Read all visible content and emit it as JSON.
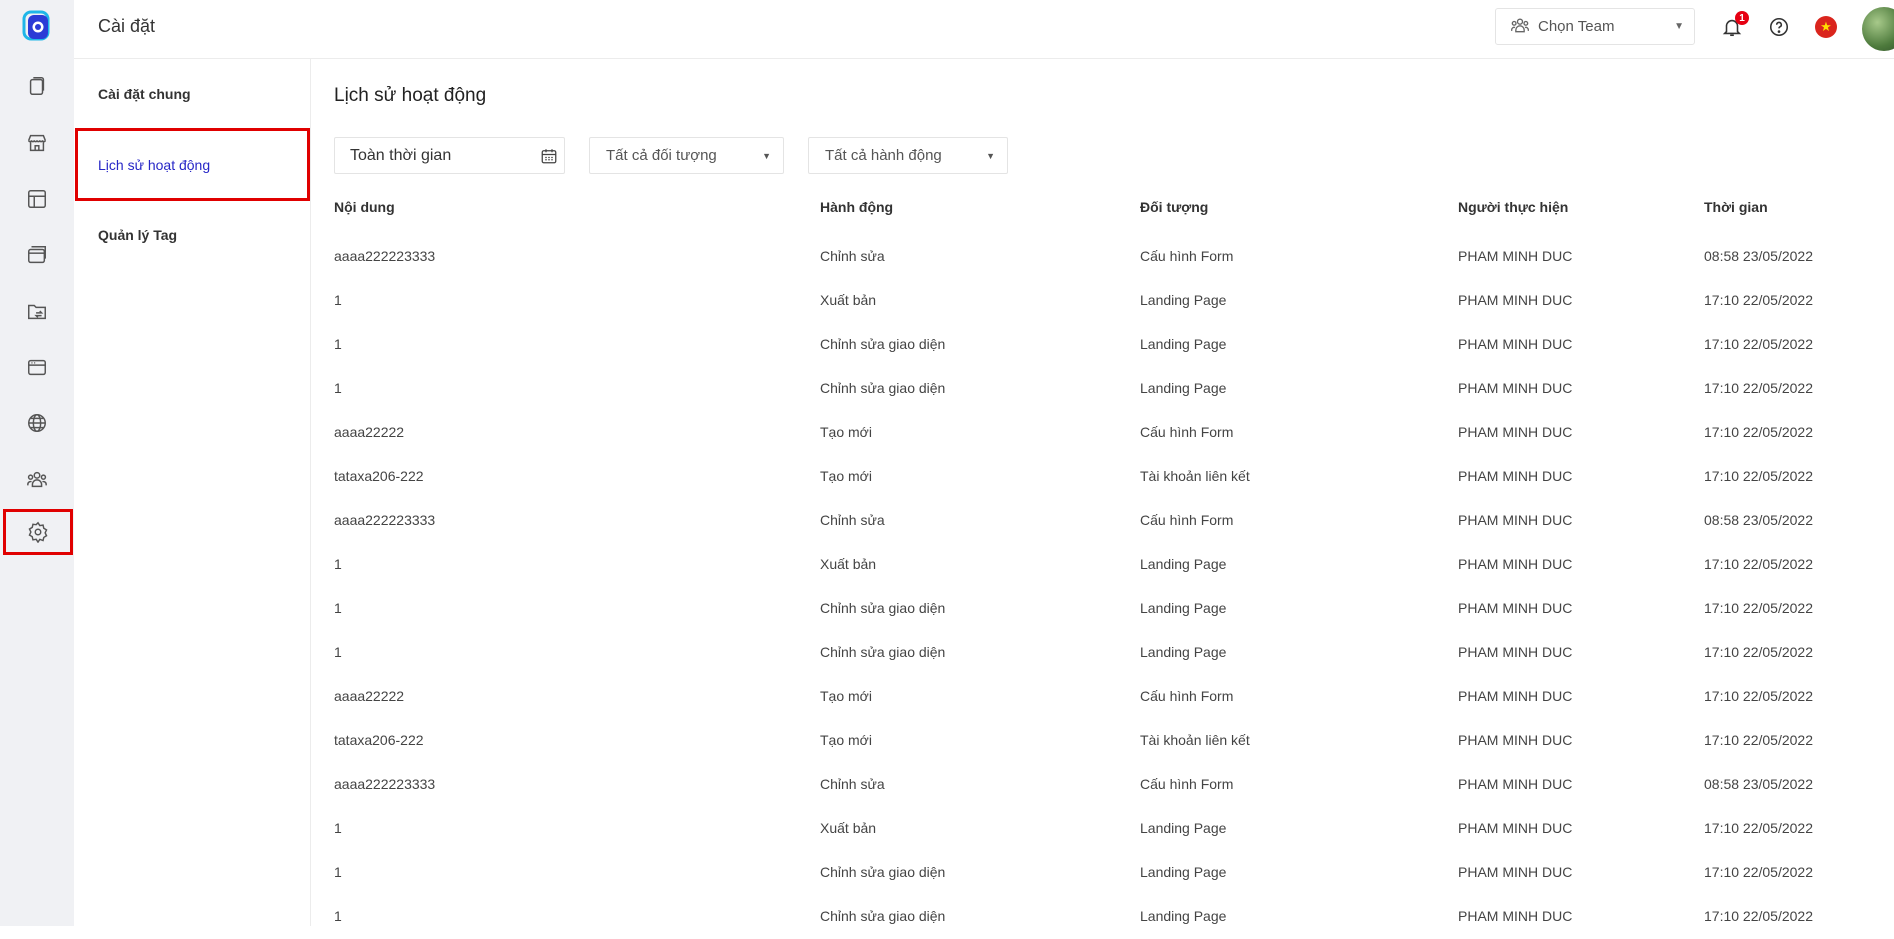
{
  "header": {
    "title": "Cài đặt",
    "team_label": "Chọn Team",
    "notification_count": "1"
  },
  "subnav": {
    "items": [
      "Cài đặt chung",
      "Lịch sử hoạt động",
      "Quản lý Tag"
    ],
    "active_index": 1
  },
  "main": {
    "title": "Lịch sử hoạt động",
    "filters": {
      "date_value": "Toàn thời gian",
      "object_select": "Tất cả đối tượng",
      "action_select": "Tất cả hành động"
    },
    "columns": [
      "Nội dung",
      "Hành động",
      "Đối tượng",
      "Người thực hiện",
      "Thời gian"
    ],
    "rows": [
      [
        "aaaa222223333",
        "Chỉnh sửa",
        "Cấu hình Form",
        "PHAM MINH DUC",
        "08:58 23/05/2022"
      ],
      [
        "1",
        "Xuất bản",
        "Landing Page",
        "PHAM MINH DUC",
        "17:10 22/05/2022"
      ],
      [
        "1",
        "Chỉnh sửa giao diện",
        "Landing Page",
        "PHAM MINH DUC",
        "17:10 22/05/2022"
      ],
      [
        "1",
        "Chỉnh sửa giao diện",
        "Landing Page",
        "PHAM MINH DUC",
        "17:10 22/05/2022"
      ],
      [
        "aaaa22222",
        "Tạo mới",
        "Cấu hình Form",
        "PHAM MINH DUC",
        "17:10 22/05/2022"
      ],
      [
        "tataxa206-222",
        "Tạo mới",
        "Tài khoản liên kết",
        "PHAM MINH DUC",
        "17:10 22/05/2022"
      ],
      [
        "aaaa222223333",
        "Chỉnh sửa",
        "Cấu hình Form",
        "PHAM MINH DUC",
        "08:58 23/05/2022"
      ],
      [
        "1",
        "Xuất bản",
        "Landing Page",
        "PHAM MINH DUC",
        "17:10 22/05/2022"
      ],
      [
        "1",
        "Chỉnh sửa giao diện",
        "Landing Page",
        "PHAM MINH DUC",
        "17:10 22/05/2022"
      ],
      [
        "1",
        "Chỉnh sửa giao diện",
        "Landing Page",
        "PHAM MINH DUC",
        "17:10 22/05/2022"
      ],
      [
        "aaaa22222",
        "Tạo mới",
        "Cấu hình Form",
        "PHAM MINH DUC",
        "17:10 22/05/2022"
      ],
      [
        "tataxa206-222",
        "Tạo mới",
        "Tài khoản liên kết",
        "PHAM MINH DUC",
        "17:10 22/05/2022"
      ],
      [
        "aaaa222223333",
        "Chỉnh sửa",
        "Cấu hình Form",
        "PHAM MINH DUC",
        "08:58 23/05/2022"
      ],
      [
        "1",
        "Xuất bản",
        "Landing Page",
        "PHAM MINH DUC",
        "17:10 22/05/2022"
      ],
      [
        "1",
        "Chỉnh sửa giao diện",
        "Landing Page",
        "PHAM MINH DUC",
        "17:10 22/05/2022"
      ],
      [
        "1",
        "Chỉnh sửa giao diện",
        "Landing Page",
        "PHAM MINH DUC",
        "17:10 22/05/2022"
      ]
    ]
  },
  "icons": [
    "app-logo-icon",
    "pages-icon",
    "store-icon",
    "layout-icon",
    "window-icon",
    "folder-sync-icon",
    "browser-icon",
    "globe-icon",
    "team-icon",
    "settings-icon",
    "bell-icon",
    "help-icon",
    "vietnam-flag-icon",
    "calendar-icon"
  ],
  "colors": {
    "accent": "#2727c7",
    "highlight": "#e00000",
    "rail_bg": "#f0f1f4",
    "badge": "#e60012"
  }
}
